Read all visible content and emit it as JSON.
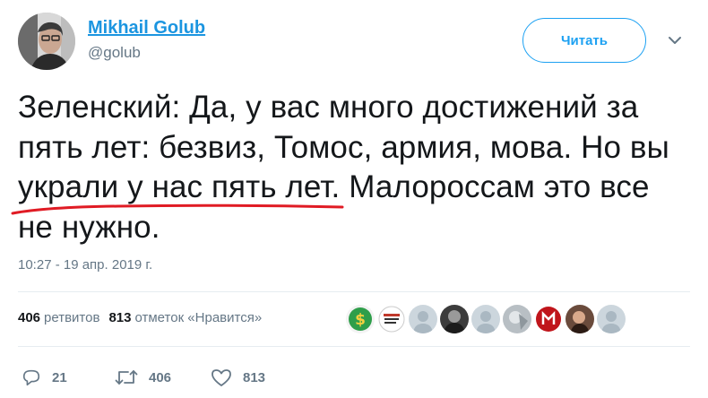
{
  "author": {
    "display_name": "Mikhail Golub",
    "handle": "@golub",
    "avatar_icon": "user-photo-avatar"
  },
  "follow_button": {
    "label": "Читать",
    "color": "#1da1f2"
  },
  "menu_icon": "chevron-down-icon",
  "tweet": {
    "lines": [
      "Зеленский: Да, у вас много достижений за",
      "пять лет: безвиз, Томос, армия, мова. Но вы",
      "украли у нас пять лет. Малороссам это все",
      "не нужно."
    ],
    "highlight_color": "#e01b24"
  },
  "timestamp": "10:27 - 19 апр. 2019 г.",
  "stats": {
    "retweets_count": "406",
    "retweets_label": "ретвитов",
    "likes_count": "813",
    "likes_label": "отметок «Нравится»"
  },
  "liker_avatars": [
    "dollar-sign-avatar",
    "badge-text-avatar",
    "default-user-avatar",
    "bw-portrait-avatar",
    "default-user-avatar",
    "silver-photo-avatar",
    "red-emblem-avatar",
    "portrait-photo-avatar",
    "default-user-avatar"
  ],
  "actions": {
    "reply_count": "21",
    "retweet_count": "406",
    "like_count": "813"
  },
  "colors": {
    "link_blue": "#1b95e0",
    "text": "#14171a",
    "secondary_text": "#657786",
    "divider": "#e6ecf0"
  }
}
